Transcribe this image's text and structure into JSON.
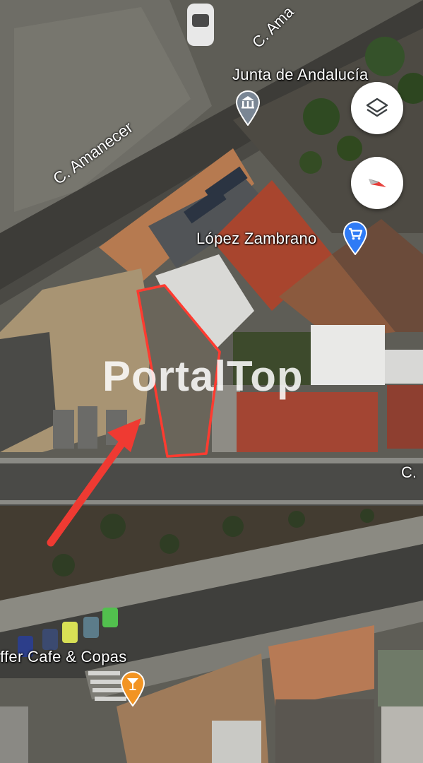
{
  "map": {
    "streets": {
      "amanecer": "C. Amanecer",
      "amanecer_top": "C. Ama",
      "right_edge": "C."
    },
    "places": {
      "junta": "Junta de Andalucía",
      "lopez": "López Zambrano",
      "cafe": "ffer Cafe & Copas"
    },
    "icons": {
      "junta": "government-building-icon",
      "lopez": "shopping-cart-icon",
      "cafe": "cocktail-glass-icon"
    },
    "colors": {
      "parcel_outline": "#ff3b30",
      "arrow": "#ef3a32",
      "poi_gray": "#7a8694",
      "poi_blue": "#2f7bf5",
      "poi_orange": "#f29423"
    }
  },
  "controls": {
    "layers": "layers-icon",
    "compass": "compass-icon"
  },
  "watermark": {
    "text": "PortalTop"
  }
}
